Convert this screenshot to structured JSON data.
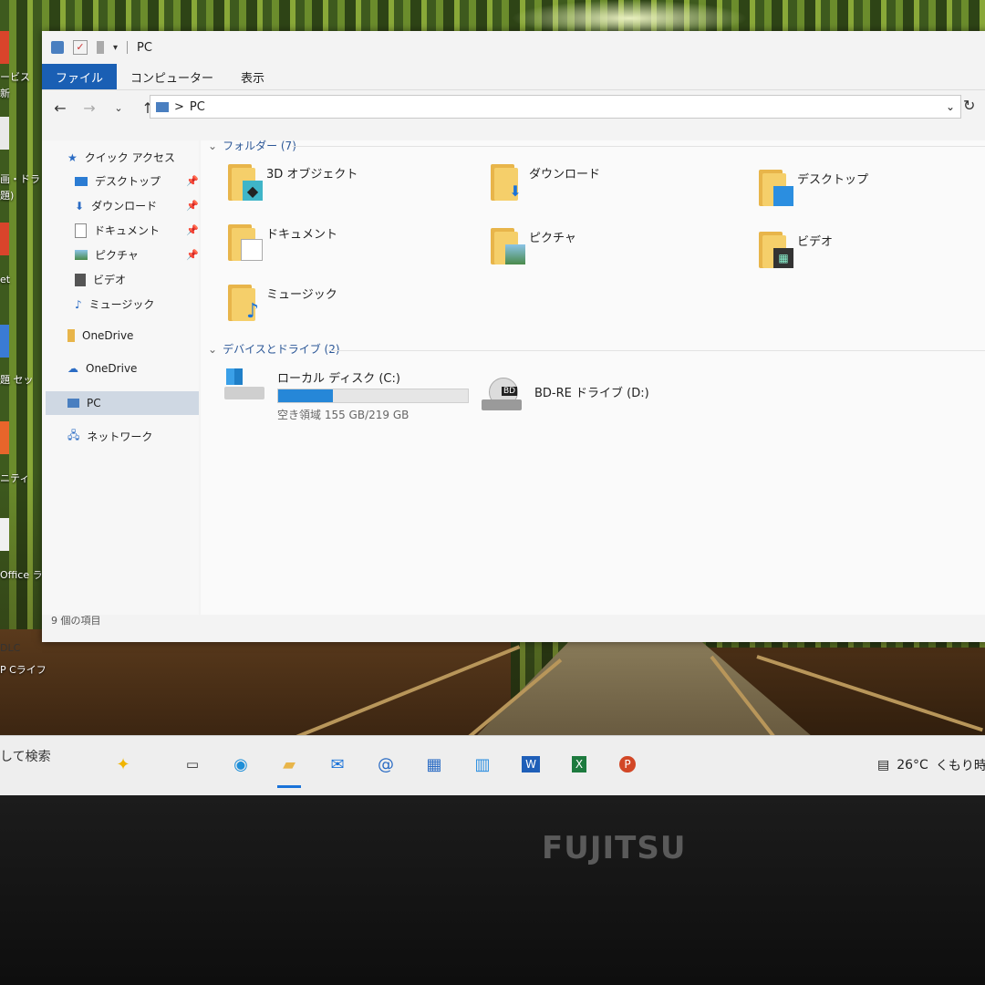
{
  "desktop": {
    "labels": [
      "ービス",
      "新",
      "画・ドラ",
      "題)",
      "et",
      "題 セッ",
      "ニティ",
      "Office ラ",
      "DLC",
      "P Cライフ"
    ]
  },
  "window": {
    "title": "PC",
    "ribbon_tabs": [
      "ファイル",
      "コンピューター",
      "表示"
    ],
    "address": "PC",
    "address_sep": ">"
  },
  "sidebar": {
    "quick_access": "クイック アクセス",
    "items": [
      {
        "label": "デスクトップ",
        "pinned": true
      },
      {
        "label": "ダウンロード",
        "pinned": true
      },
      {
        "label": "ドキュメント",
        "pinned": true
      },
      {
        "label": "ピクチャ",
        "pinned": true
      },
      {
        "label": "ビデオ",
        "pinned": false
      },
      {
        "label": "ミュージック",
        "pinned": false
      }
    ],
    "onedrive_1": "OneDrive",
    "onedrive_2": "OneDrive",
    "pc": "PC",
    "network": "ネットワーク"
  },
  "folders_group": {
    "header": "フォルダー (7)",
    "items": [
      {
        "label": "3D オブジェクト",
        "icon": "3d-objects-icon"
      },
      {
        "label": "ダウンロード",
        "icon": "download-icon"
      },
      {
        "label": "デスクトップ",
        "icon": "desktop-icon"
      },
      {
        "label": "ドキュメント",
        "icon": "document-icon"
      },
      {
        "label": "ピクチャ",
        "icon": "picture-icon"
      },
      {
        "label": "ビデオ",
        "icon": "video-icon"
      },
      {
        "label": "ミュージック",
        "icon": "music-icon"
      }
    ]
  },
  "drives_group": {
    "header": "デバイスとドライブ (2)",
    "local_disk": {
      "label": "ローカル ディスク (C:)",
      "free_text": "空き領域 155 GB/219 GB",
      "used_fraction": 0.29
    },
    "bd_drive": {
      "label": "BD-RE ドライブ (D:)",
      "badge": "BD"
    }
  },
  "status": {
    "item_count": "9 個の項目"
  },
  "taskbar": {
    "search": "して検索",
    "weather_temp": "26°C",
    "weather_desc": "くもり時"
  },
  "bezel": {
    "brand": "FUJITSU"
  },
  "colors": {
    "accent": "#1a5fb4",
    "progress": "#2687d8",
    "folder": "#f5cf6a"
  }
}
